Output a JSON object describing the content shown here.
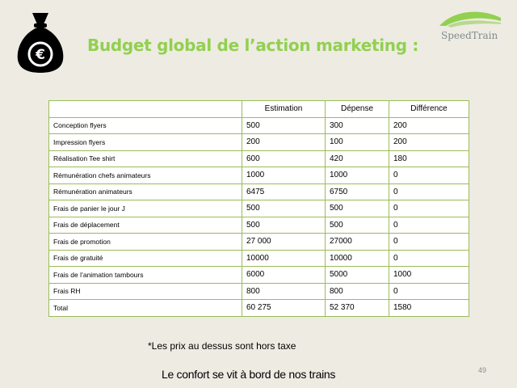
{
  "header": {
    "title": "Budget global de l’action marketing :",
    "icon": "money-bag-euro-icon",
    "logo_text": "SpeedTrain",
    "title_color": "#92d050"
  },
  "table": {
    "columns": [
      "",
      "Estimation",
      "Dépense",
      "Différence"
    ],
    "rows": [
      {
        "label": "Conception flyers",
        "estimation": "500",
        "depense": "300",
        "difference": "200"
      },
      {
        "label": "Impression flyers",
        "estimation": "200",
        "depense": "100",
        "difference": "200"
      },
      {
        "label": "Réalisation Tee shirt",
        "estimation": "600",
        "depense": "420",
        "difference": "180"
      },
      {
        "label": "Rémunération chefs animateurs",
        "estimation": "1000",
        "depense": "1000",
        "difference": "0"
      },
      {
        "label": "Rémunération animateurs",
        "estimation": "6475",
        "depense": "6750",
        "difference": "0"
      },
      {
        "label": "Frais de panier le jour J",
        "estimation": "500",
        "depense": "500",
        "difference": "0"
      },
      {
        "label": "Frais de déplacement",
        "estimation": "500",
        "depense": "500",
        "difference": "0"
      },
      {
        "label": "Frais de promotion",
        "estimation": "27 000",
        "depense": "27000",
        "difference": "0"
      },
      {
        "label": "Frais de gratuité",
        "estimation": "10000",
        "depense": "10000",
        "difference": "0"
      },
      {
        "label": "Frais de l’animation tambours",
        "estimation": "6000",
        "depense": "5000",
        "difference": "1000"
      },
      {
        "label": "Frais RH",
        "estimation": "800",
        "depense": "800",
        "difference": "0"
      },
      {
        "label": "Total",
        "estimation": "60 275",
        "depense": "52 370",
        "difference": "1580"
      }
    ],
    "border_color": "#9bbb59"
  },
  "note": "*Les prix au dessus sont hors taxe",
  "footer": {
    "slogan": "Le confort se vit à bord de nos trains",
    "page_number": "49"
  }
}
